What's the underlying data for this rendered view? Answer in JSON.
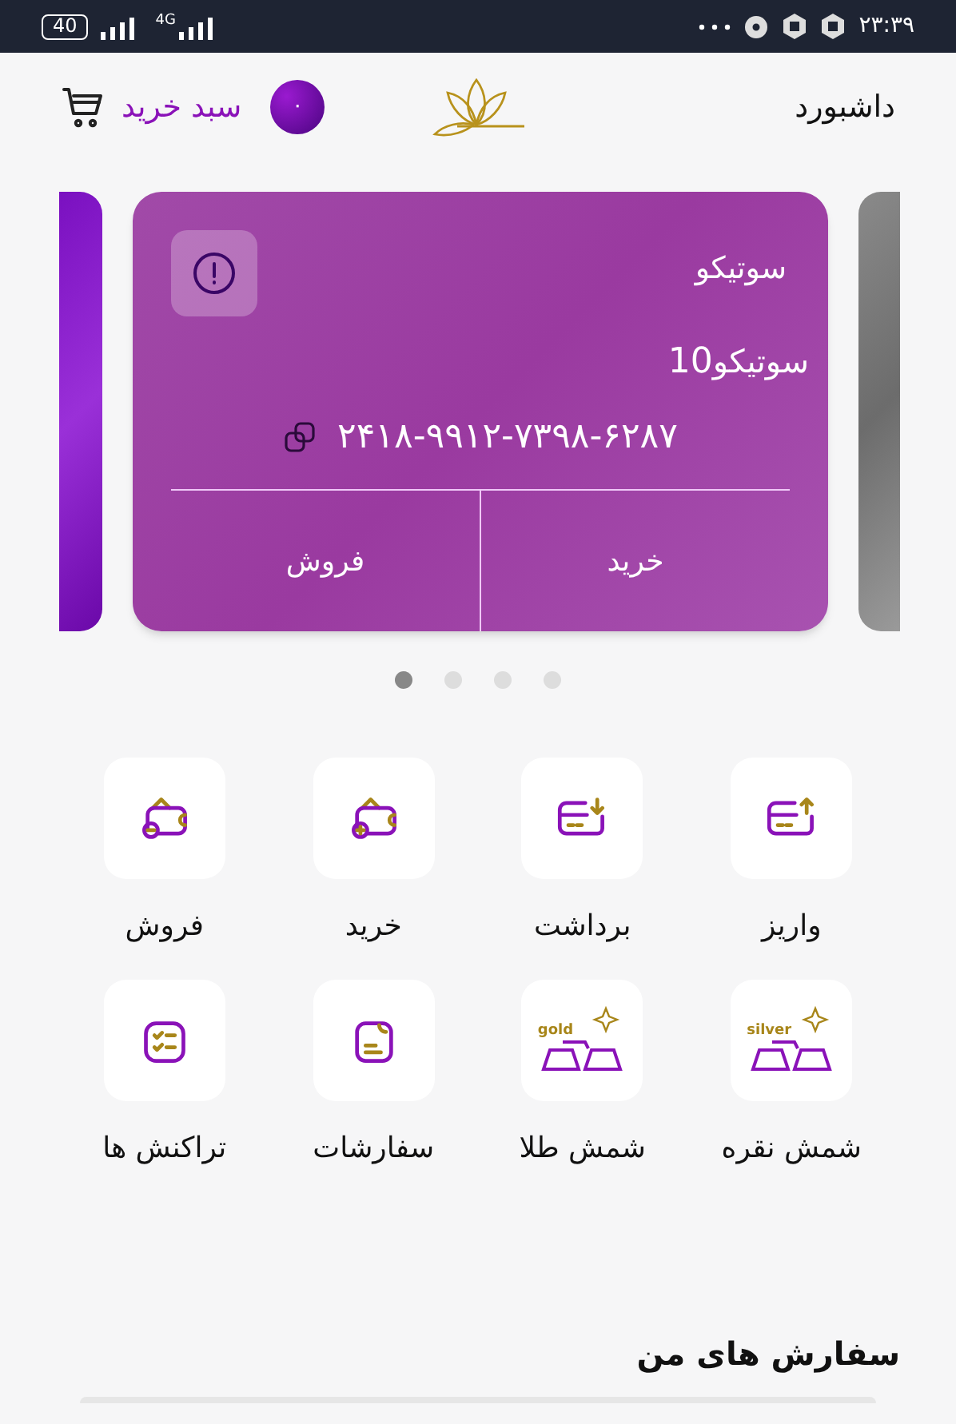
{
  "status_bar": {
    "battery": "40",
    "network": "4G",
    "time": "۲۳:۳۹"
  },
  "header": {
    "title": "داشبورد",
    "cart_label": "سبد خرید",
    "cart_count": "۰"
  },
  "carousel": {
    "card": {
      "title": "سوتیکو",
      "amount": "10",
      "unit": "سوتیکو",
      "number": "۲۴۱۸-۹۹۱۲-۷۳۹۸-۶۲۸۷",
      "actions": [
        "خرید",
        "فروش"
      ]
    },
    "dots": [
      {
        "selected": true
      },
      {
        "selected": false
      },
      {
        "selected": false
      },
      {
        "selected": false
      }
    ]
  },
  "actions": [
    {
      "label": "واریز",
      "kind": "deposit"
    },
    {
      "label": "برداشت",
      "kind": "withdraw"
    },
    {
      "label": "خرید",
      "kind": "buy"
    },
    {
      "label": "فروش",
      "kind": "sell"
    },
    {
      "label": "شمش نقره",
      "kind": "bars",
      "icon_text": "silver"
    },
    {
      "label": "شمش طلا",
      "kind": "bars",
      "icon_text": "gold"
    },
    {
      "label": "سفارشات",
      "kind": "orders"
    },
    {
      "label": "تراکنش ها",
      "kind": "transactions"
    }
  ],
  "orders_section": {
    "title": "سفارش های من"
  }
}
